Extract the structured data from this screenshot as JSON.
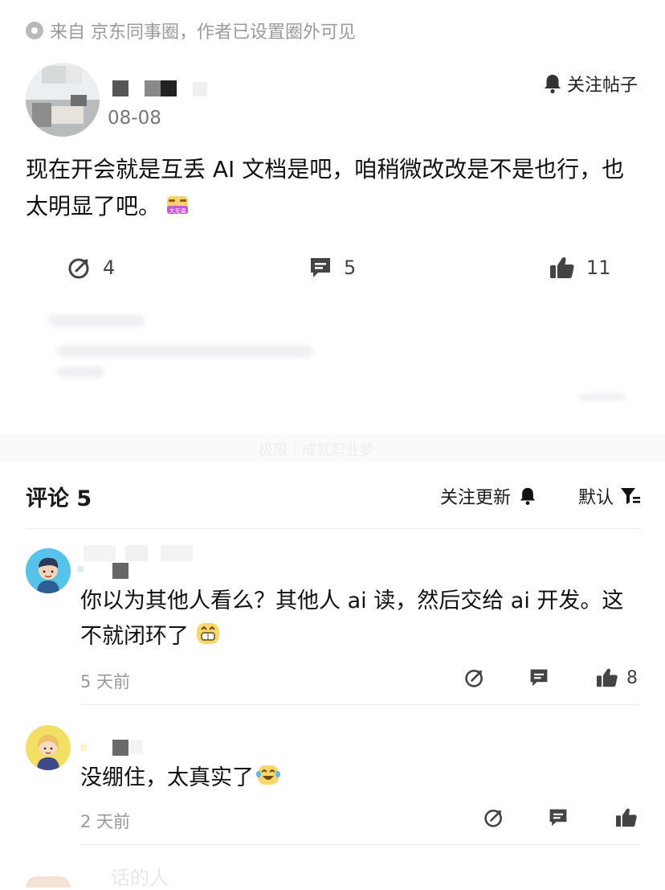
{
  "source": {
    "text": "来自 京东同事圈，作者已设置圈外可见"
  },
  "post": {
    "date": "08-08",
    "follow_label": "关注帖子",
    "text": "现在开会就是互丢 AI 文档是吧，咱稍微改改是不是也行，也太明显了吧。",
    "emoji_text": "大无语",
    "repost_count": "4",
    "comment_count": "5",
    "like_count": "11"
  },
  "faded_banner_text": "极限｜成就职业梦",
  "comments_header": {
    "title": "评论 5",
    "follow_updates": "关注更新",
    "sort": "默认"
  },
  "comments": [
    {
      "text": "你以为其他人看么？其他人 ai 读，然后交给 ai 开发。这不就闭环了",
      "time": "5 天前",
      "like_count": "8"
    },
    {
      "text": "没绷住，太真实了",
      "time": "2 天前",
      "like_count": ""
    }
  ],
  "next_comment_partial": "话的人",
  "colors": {
    "accent": "#222222",
    "muted": "#9a9a9a",
    "divider": "#ececec"
  }
}
